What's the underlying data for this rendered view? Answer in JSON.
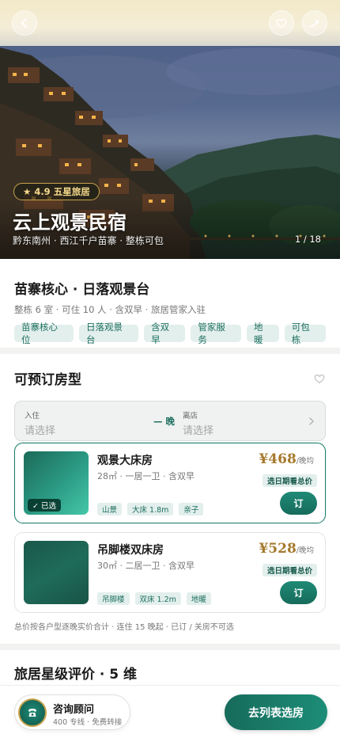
{
  "hero": {
    "rating_badge": "★ 4.9 五星旅居",
    "title": "云上观景民宿",
    "subtitle": "黔东南州 · 西江千户苗寨 · 整栋可包",
    "photo_counter": "1 / 18"
  },
  "summary": {
    "title": "苗寨核心 · 日落观景台",
    "meta": "整栋 6 室 · 可住 10 人 · 含双早 · 旅居管家入驻",
    "tags": [
      "苗寨核心位",
      "日落观景台",
      "含双早",
      "管家服务",
      "地暖",
      "可包栋"
    ]
  },
  "rooms": {
    "title": "可预订房型",
    "checkin_label": "入住",
    "checkin_value": "请选择",
    "nights": "— 晚",
    "checkout_label": "离店",
    "checkout_value": "请选择",
    "list": [
      {
        "name": "观景大床房",
        "info": "28㎡ · 一居一卫 · 含双早",
        "tags": [
          "山景",
          "大床 1.8m",
          "亲子"
        ],
        "price": "¥468",
        "unit": "/晚均",
        "total_label": "选日期看总价",
        "book_label": "订",
        "selected_label": "✓ 已选"
      },
      {
        "name": "吊脚楼双床房",
        "info": "30㎡ · 二居一卫 · 含双早",
        "tags": [
          "吊脚楼",
          "双床 1.2m",
          "地暖"
        ],
        "price": "¥528",
        "unit": "/晚均",
        "total_label": "选日期看总价",
        "book_label": "订"
      }
    ],
    "note": "总价按各户型逐晚实价合计 · 连住 15 晚起 · 已订 / 关房不可选"
  },
  "reviews": {
    "title": "旅居星级评价 · 5 维"
  },
  "bottom": {
    "consult_title": "咨询顾问",
    "consult_sub": "400 专线 · 免费转接",
    "choose_label": "去列表选房"
  },
  "colors": {
    "accent": "#1b7e6c",
    "gold": "#a5792c",
    "tag_bg": "#e3efec"
  }
}
